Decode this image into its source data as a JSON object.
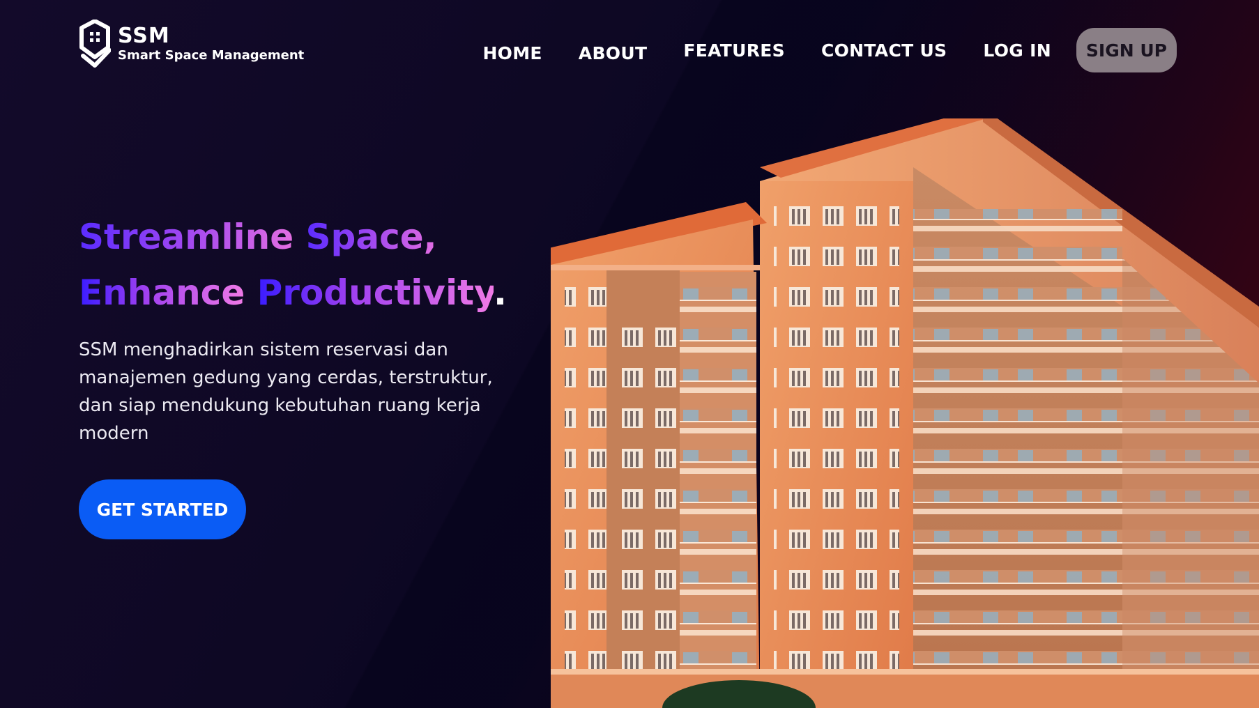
{
  "brand": {
    "name": "SSM",
    "tagline": "Smart Space Management"
  },
  "nav": {
    "items": [
      {
        "label": "HOME"
      },
      {
        "label": "ABOUT"
      },
      {
        "label": "FEATURES"
      },
      {
        "label": "CONTACT US"
      },
      {
        "label": "LOG IN"
      }
    ],
    "signup_label": "SIGN UP"
  },
  "hero": {
    "line1_word1": "Streamline",
    "line1_word2": "Space,",
    "line2_word1": "Enhance",
    "line2_word2": "Productivity",
    "line2_period": ".",
    "description": "SSM menghadirkan sistem reservasi dan manajemen gedung yang cerdas, terstruktur, dan siap mendukung kebutuhan ruang kerja modern",
    "cta_label": "GET STARTED"
  },
  "colors": {
    "background": "#0d0820",
    "accent_purple": "#5b2cff",
    "accent_pink": "#e36ee2",
    "cta_blue": "#0a5cf5",
    "signup_bg": "#8a7f86",
    "building_orange": "#e8905e"
  },
  "icons": {
    "logo": "building-shield-icon"
  }
}
